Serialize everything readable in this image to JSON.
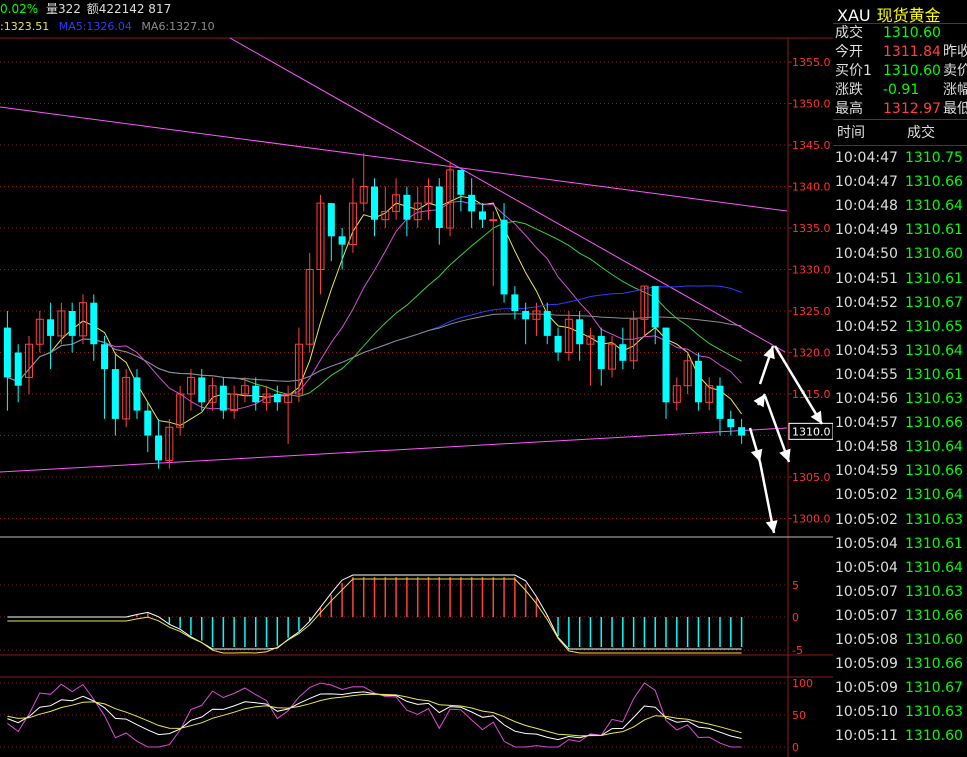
{
  "header": {
    "pct": "0.02%",
    "volume": "量322",
    "amount": "额422142 817"
  },
  "ma_row": {
    "ma1": ":1323.51",
    "ma5": "MA5:1326.04",
    "ma6": "MA6:1327.10"
  },
  "colors": {
    "up": "#ff4040",
    "down": "#00ffff",
    "grid": "#8a1b1b",
    "axis_text": "#ff3030",
    "trendline": "#ff55ff",
    "ma_yellow": "#e8e84a",
    "ma_magenta": "#d94ad9",
    "ma_green": "#3ad03a",
    "ma_blue": "#2a3cff",
    "ma_gray": "#8c8c8c",
    "arrow": "#ffffff"
  },
  "price_axis": [
    "1355.0",
    "1350.0",
    "1345.0",
    "1340.0",
    "1335.0",
    "1330.0",
    "1325.0",
    "1320.0",
    "1315.0",
    "1310.0",
    "1305.0",
    "1300.0"
  ],
  "current_price_label": "1310.0",
  "macd_axis": [
    "5",
    "0",
    "-5"
  ],
  "kdj_axis": [
    "100",
    "50",
    "0"
  ],
  "quote_panel": {
    "symbol": "XAU",
    "name": "现货黄金",
    "rows": [
      {
        "label": "成交",
        "value": "1310.60",
        "color": "#0f0",
        "extra": ""
      },
      {
        "label": "今开",
        "value": "1311.84",
        "color": "#ff4040",
        "extra": "昨收"
      },
      {
        "label": "买价1",
        "value": "1310.60",
        "color": "#0f0",
        "extra": "卖价"
      },
      {
        "label": "涨跌",
        "value": "-0.91",
        "color": "#0f0",
        "extra": "涨幅"
      },
      {
        "label": "最高",
        "value": "1312.97",
        "color": "#ff4040",
        "extra": "最低"
      }
    ]
  },
  "ticks_header": {
    "time": "时间",
    "price": "成交"
  },
  "ticks": [
    {
      "time": "10:04:47",
      "price": "1310.75"
    },
    {
      "time": "10:04:47",
      "price": "1310.66"
    },
    {
      "time": "10:04:48",
      "price": "1310.64"
    },
    {
      "time": "10:04:49",
      "price": "1310.61"
    },
    {
      "time": "10:04:50",
      "price": "1310.60"
    },
    {
      "time": "10:04:51",
      "price": "1310.61"
    },
    {
      "time": "10:04:52",
      "price": "1310.67"
    },
    {
      "time": "10:04:52",
      "price": "1310.65"
    },
    {
      "time": "10:04:53",
      "price": "1310.64"
    },
    {
      "time": "10:04:55",
      "price": "1310.61"
    },
    {
      "time": "10:04:56",
      "price": "1310.63"
    },
    {
      "time": "10:04:57",
      "price": "1310.66"
    },
    {
      "time": "10:04:58",
      "price": "1310.64"
    },
    {
      "time": "10:04:59",
      "price": "1310.66"
    },
    {
      "time": "10:05:02",
      "price": "1310.64"
    },
    {
      "time": "10:05:02",
      "price": "1310.63"
    },
    {
      "time": "10:05:04",
      "price": "1310.61"
    },
    {
      "time": "10:05:04",
      "price": "1310.64"
    },
    {
      "time": "10:05:07",
      "price": "1310.63"
    },
    {
      "time": "10:05:07",
      "price": "1310.66"
    },
    {
      "time": "10:05:08",
      "price": "1310.60"
    },
    {
      "time": "10:05:09",
      "price": "1310.66"
    },
    {
      "time": "10:05:09",
      "price": "1310.67"
    },
    {
      "time": "10:05:10",
      "price": "1310.63"
    },
    {
      "time": "10:05:11",
      "price": "1310.60"
    }
  ],
  "candles": [
    [
      1323,
      1317,
      1325,
      1313
    ],
    [
      1320,
      1316,
      1321,
      1314
    ],
    [
      1317,
      1321,
      1322,
      1315
    ],
    [
      1321,
      1324,
      1325,
      1320
    ],
    [
      1324,
      1322,
      1326,
      1318
    ],
    [
      1322,
      1325,
      1326,
      1321
    ],
    [
      1325,
      1322,
      1326,
      1320
    ],
    [
      1322,
      1326,
      1327,
      1321
    ],
    [
      1326,
      1321,
      1327,
      1319
    ],
    [
      1321,
      1318,
      1322,
      1312
    ],
    [
      1318,
      1312,
      1320,
      1310
    ],
    [
      1312,
      1317,
      1318,
      1311
    ],
    [
      1317,
      1313,
      1318,
      1312
    ],
    [
      1313,
      1310,
      1314,
      1308
    ],
    [
      1310,
      1307,
      1312,
      1306
    ],
    [
      1307,
      1311,
      1312,
      1306
    ],
    [
      1311,
      1315,
      1316,
      1310
    ],
    [
      1315,
      1317,
      1318,
      1313
    ],
    [
      1317,
      1314,
      1318,
      1313
    ],
    [
      1314,
      1316,
      1317,
      1313
    ],
    [
      1316,
      1313,
      1317,
      1312
    ],
    [
      1313,
      1315,
      1316,
      1312
    ],
    [
      1315,
      1316,
      1317,
      1314
    ],
    [
      1316,
      1314,
      1317,
      1313
    ],
    [
      1314,
      1315,
      1316,
      1313
    ],
    [
      1315,
      1314,
      1316,
      1313
    ],
    [
      1314,
      1315,
      1316,
      1309
    ],
    [
      1315,
      1321,
      1323,
      1314
    ],
    [
      1321,
      1330,
      1332,
      1320
    ],
    [
      1330,
      1338,
      1339,
      1327
    ],
    [
      1338,
      1334,
      1338,
      1331
    ],
    [
      1334,
      1333,
      1335,
      1330
    ],
    [
      1333,
      1338,
      1341,
      1332
    ],
    [
      1338,
      1340,
      1344,
      1337
    ],
    [
      1340,
      1336,
      1341,
      1334
    ],
    [
      1336,
      1337,
      1340,
      1335
    ],
    [
      1337,
      1339,
      1341,
      1336
    ],
    [
      1339,
      1336,
      1340,
      1334
    ],
    [
      1336,
      1338,
      1340,
      1335
    ],
    [
      1338,
      1340,
      1341,
      1336
    ],
    [
      1340,
      1335,
      1341,
      1333
    ],
    [
      1335,
      1342,
      1343,
      1334
    ],
    [
      1342,
      1339,
      1342,
      1337
    ],
    [
      1339,
      1337,
      1341,
      1335
    ],
    [
      1337,
      1336,
      1338,
      1335
    ],
    [
      1336,
      1336,
      1337,
      1328
    ],
    [
      1336,
      1327,
      1338,
      1326
    ],
    [
      1327,
      1325,
      1328,
      1324
    ],
    [
      1325,
      1324,
      1326,
      1321
    ],
    [
      1324,
      1325,
      1326,
      1322
    ],
    [
      1325,
      1322,
      1326,
      1321
    ],
    [
      1322,
      1320,
      1323,
      1319
    ],
    [
      1320,
      1324,
      1325,
      1319
    ],
    [
      1324,
      1321,
      1325,
      1319
    ],
    [
      1321,
      1322,
      1323,
      1316
    ],
    [
      1322,
      1318,
      1323,
      1316
    ],
    [
      1318,
      1321,
      1322,
      1317
    ],
    [
      1321,
      1319,
      1323,
      1318
    ],
    [
      1319,
      1324,
      1325,
      1318
    ],
    [
      1324,
      1328,
      1328,
      1322
    ],
    [
      1328,
      1323,
      1328,
      1321
    ],
    [
      1323,
      1314,
      1323,
      1312
    ],
    [
      1314,
      1316,
      1317,
      1313
    ],
    [
      1316,
      1319,
      1320,
      1315
    ],
    [
      1319,
      1314,
      1320,
      1313
    ],
    [
      1314,
      1316,
      1317,
      1313
    ],
    [
      1316,
      1312,
      1317,
      1310
    ],
    [
      1312,
      1311,
      1313,
      1310
    ],
    [
      1311,
      1310,
      1312,
      1309
    ]
  ]
}
